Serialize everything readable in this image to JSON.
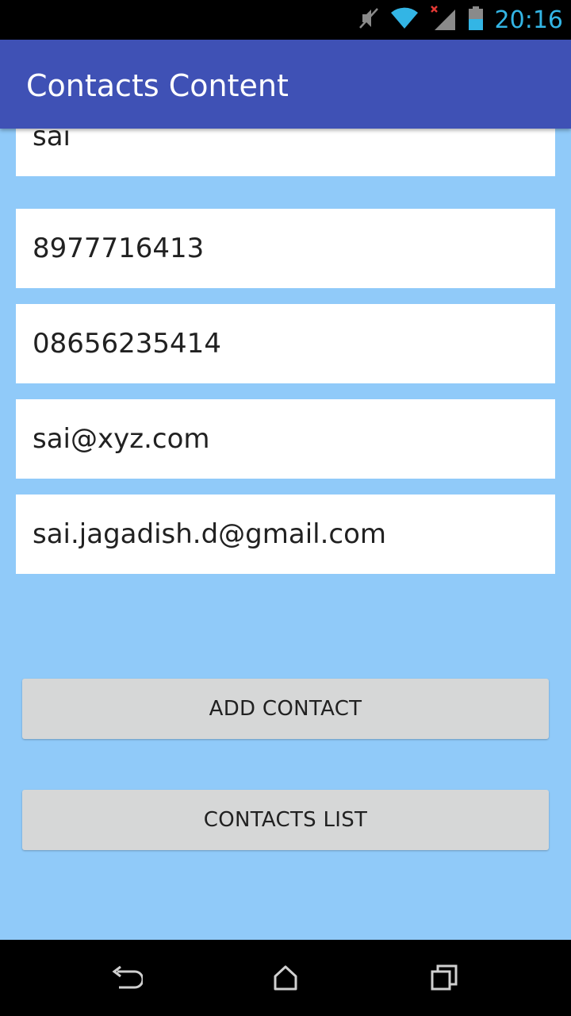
{
  "status_bar": {
    "time": "20:16",
    "icons": [
      "mute-icon",
      "wifi-icon",
      "signal-no-service-icon",
      "battery-icon"
    ],
    "time_color": "#33B5E5"
  },
  "app_bar": {
    "title": "Contacts Content",
    "color": "#3F51B5"
  },
  "form": {
    "fields": [
      {
        "value": "sai"
      },
      {
        "value": "8977716413"
      },
      {
        "value": "08656235414"
      },
      {
        "value": "sai@xyz.com"
      },
      {
        "value": "sai.jagadish.d@gmail.com"
      }
    ],
    "background_color": "#90CAF9"
  },
  "buttons": {
    "add_contact": "ADD CONTACT",
    "contacts_list": "CONTACTS LIST"
  },
  "nav_bar": {
    "icons": [
      "back-icon",
      "home-icon",
      "recent-apps-icon"
    ]
  }
}
